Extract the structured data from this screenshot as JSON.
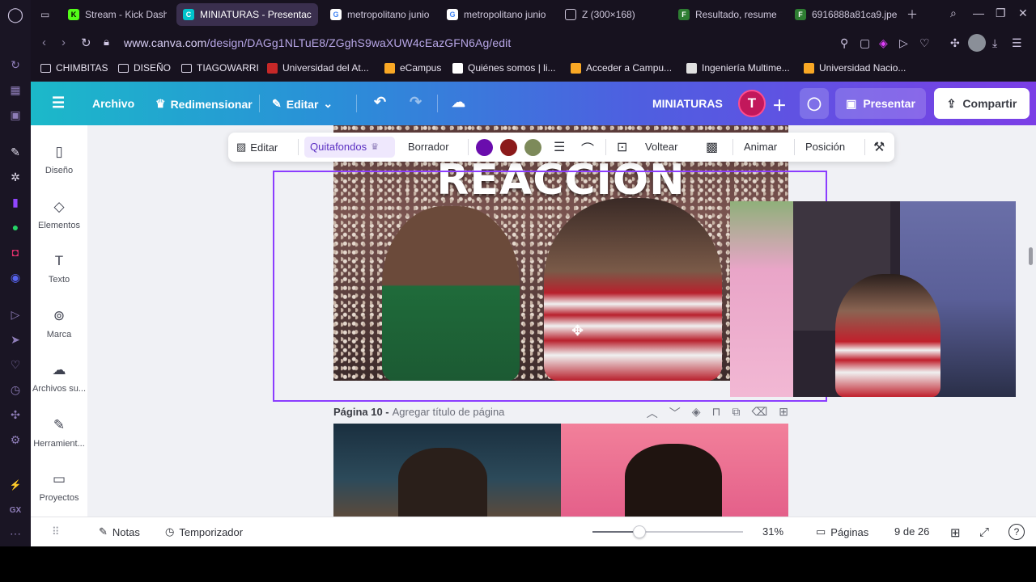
{
  "browser": {
    "tabs": [
      {
        "label": "Stream - Kick Dash",
        "favicon": "kick",
        "color": "#53fc18"
      },
      {
        "label": "MINIATURAS - Presentac",
        "favicon": "canva",
        "color": "#00c4cc",
        "active": true
      },
      {
        "label": "metropolitano junio",
        "favicon": "google",
        "color": "#ffffff"
      },
      {
        "label": "metropolitano junio",
        "favicon": "google",
        "color": "#ffffff"
      },
      {
        "label": "Z (300×168)",
        "favicon": "page",
        "color": "#cfc8dc"
      },
      {
        "label": "Resultado, resume",
        "favicon": "fm",
        "color": "#2e7d32"
      },
      {
        "label": "6916888a81ca9.jpe",
        "favicon": "fm",
        "color": "#2e7d32"
      }
    ],
    "url_prefix": "www.canva.com",
    "url_path": "/design/DAGg1NLTuE8/ZGghS9waXUW4cEazGFN6Ag/edit",
    "bookmarks": [
      "CHIMBITAS",
      "DISEÑO",
      "TIAGOWARRI",
      "Universidad del At...",
      "eCampus",
      "Quiénes somos | li...",
      "Acceder a Campu...",
      "Ingeniería Multime...",
      "Universidad Nacio..."
    ]
  },
  "header": {
    "menu_icon": "hamburger-icon",
    "archivo": "Archivo",
    "redimensionar": "Redimensionar",
    "editar": "Editar",
    "title": "MINIATURAS",
    "avatar_letter": "T",
    "presentar": "Presentar",
    "compartir": "Compartir"
  },
  "side_panel": [
    {
      "label": "Diseño",
      "icon": "layout-icon",
      "glyph": "▯"
    },
    {
      "label": "Elementos",
      "icon": "shapes-icon",
      "glyph": "◇"
    },
    {
      "label": "Texto",
      "icon": "text-icon",
      "glyph": "T"
    },
    {
      "label": "Marca",
      "icon": "brand-icon",
      "glyph": "⊚"
    },
    {
      "label": "Archivos su...",
      "icon": "upload-cloud-icon",
      "glyph": "☁"
    },
    {
      "label": "Herramient...",
      "icon": "tools-icon",
      "glyph": "✎"
    },
    {
      "label": "Proyectos",
      "icon": "folder-icon",
      "glyph": "▭"
    }
  ],
  "toolbar": {
    "editar": "Editar",
    "quitafondos": "Quitafondos",
    "borrador": "Borrador",
    "swatches": [
      "#6a0dad",
      "#8b1a1a",
      "#7d8a5a"
    ],
    "voltear": "Voltear",
    "animar": "Animar",
    "posicion": "Posición"
  },
  "canvas": {
    "image_text": "REACCION",
    "page_label": "Página 10 - ",
    "page_title_placeholder": "Agregar título de página"
  },
  "bottom": {
    "notas": "Notas",
    "temporizador": "Temporizador",
    "zoom_fraction": 0.31,
    "zoom": "31%",
    "paginas": "Páginas",
    "page_count": "9 de 26"
  }
}
